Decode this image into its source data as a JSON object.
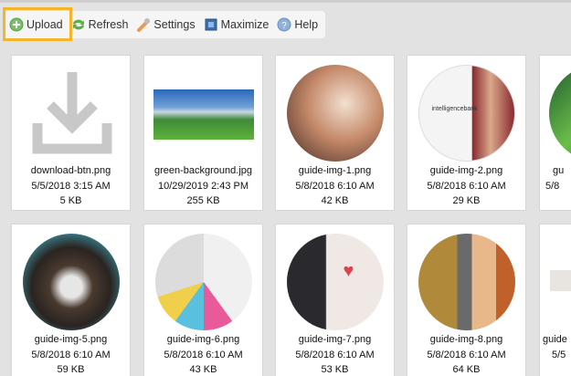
{
  "toolbar": {
    "upload": "Upload",
    "refresh": "Refresh",
    "settings": "Settings",
    "maximize": "Maximize",
    "help": "Help",
    "highlight_color": "#f5b42a"
  },
  "files": [
    {
      "name": "download-btn.png",
      "date": "5/5/2018 3:15 AM",
      "size": "5 KB"
    },
    {
      "name": "green-background.jpg",
      "date": "10/29/2019 2:43 PM",
      "size": "255 KB"
    },
    {
      "name": "guide-img-1.png",
      "date": "5/8/2018 6:10 AM",
      "size": "42 KB"
    },
    {
      "name": "guide-img-2.png",
      "date": "5/8/2018 6:10 AM",
      "size": "29 KB"
    },
    {
      "name": "gu",
      "date": "5/8",
      "size": ""
    },
    {
      "name": "guide-img-5.png",
      "date": "5/8/2018 6:10 AM",
      "size": "59 KB"
    },
    {
      "name": "guide-img-6.png",
      "date": "5/8/2018 6:10 AM",
      "size": "43 KB"
    },
    {
      "name": "guide-img-7.png",
      "date": "5/8/2018 6:10 AM",
      "size": "53 KB"
    },
    {
      "name": "guide-img-8.png",
      "date": "5/8/2018 6:10 AM",
      "size": "64 KB"
    },
    {
      "name": "guide",
      "date": "5/5",
      "size": ""
    }
  ],
  "logo_text": "intelligencebank"
}
